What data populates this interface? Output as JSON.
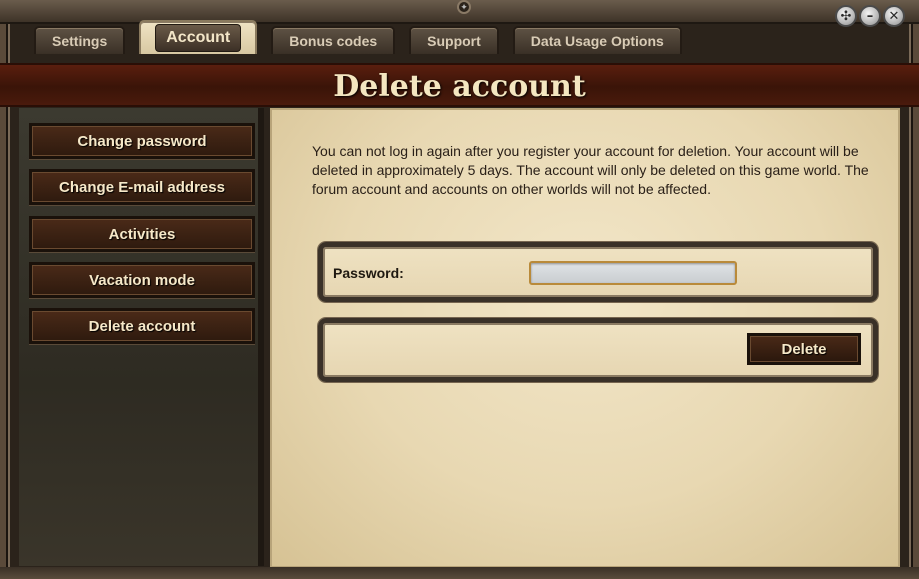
{
  "window": {
    "controls": [
      {
        "name": "help",
        "glyph": "✣"
      },
      {
        "name": "minimize",
        "glyph": "–"
      },
      {
        "name": "close",
        "glyph": "✕"
      }
    ]
  },
  "tabs": [
    {
      "label": "Settings",
      "active": false
    },
    {
      "label": "Account",
      "active": true
    },
    {
      "label": "Bonus codes",
      "active": false
    },
    {
      "label": "Support",
      "active": false
    },
    {
      "label": "Data Usage Options",
      "active": false
    }
  ],
  "header": {
    "title": "Delete account"
  },
  "sidebar": {
    "items": [
      {
        "label": "Change password"
      },
      {
        "label": "Change E-mail address"
      },
      {
        "label": "Activities"
      },
      {
        "label": "Vacation mode"
      },
      {
        "label": "Delete account"
      }
    ]
  },
  "main": {
    "description": "You can not log in again after you register your account for deletion. Your account will be deleted in approximately 5 days. The account will only be deleted on this game world. The forum account and accounts on other worlds will not be affected.",
    "password_label": "Password:",
    "password_value": "",
    "delete_label": "Delete"
  },
  "colors": {
    "header_bg": "#4a1a0c",
    "header_text": "#f4e6c0",
    "parchment": "#e8d8b2",
    "button_bg": "#3a2012",
    "button_text": "#f6e8c8",
    "input_border": "#b98a3a"
  }
}
